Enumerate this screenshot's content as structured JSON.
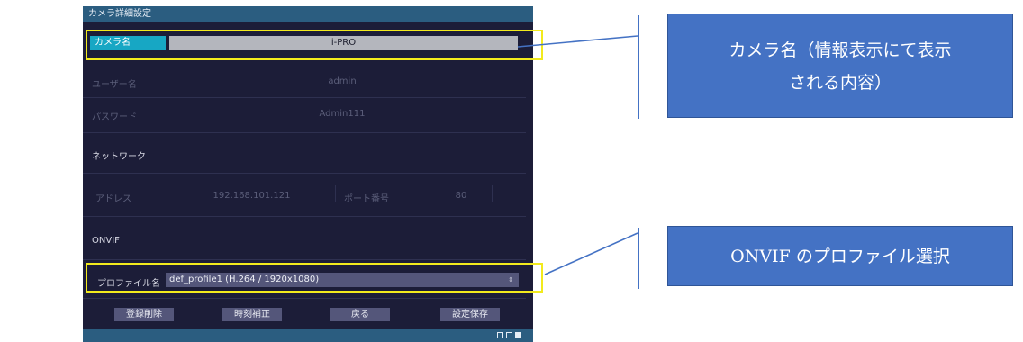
{
  "window": {
    "title": "カメラ詳細設定"
  },
  "camera_name": {
    "label": "カメラ名",
    "value": "i-PRO"
  },
  "user": {
    "label": "ユーザー名",
    "value": "admin"
  },
  "password": {
    "label": "パスワード",
    "value": "Admin111"
  },
  "network": {
    "section": "ネットワーク",
    "address_label": "アドレス",
    "address_value": "192.168.101.121",
    "port_label": "ポート番号",
    "port_value": "80"
  },
  "onvif": {
    "section": "ONVIF",
    "profile_label": "プロファイル名",
    "profile_value": "def_profile1 (H.264 / 1920x1080)",
    "dropdown_arrow": "⇕"
  },
  "buttons": {
    "delete": "登録削除",
    "time_correct": "時刻補正",
    "back": "戻る",
    "save": "設定保存"
  },
  "callouts": {
    "camera_name_line1": "カメラ名（情報表示にて表示",
    "camera_name_line2": "される内容）",
    "onvif": "ONVIF のプロファイル選択"
  },
  "colors": {
    "window_bg": "#1c1d38",
    "title_bar": "#2b5d80",
    "highlight_box": "#f2ea1d",
    "callout_bg": "#4472c4",
    "cam_label_bg": "#17a7c4"
  }
}
